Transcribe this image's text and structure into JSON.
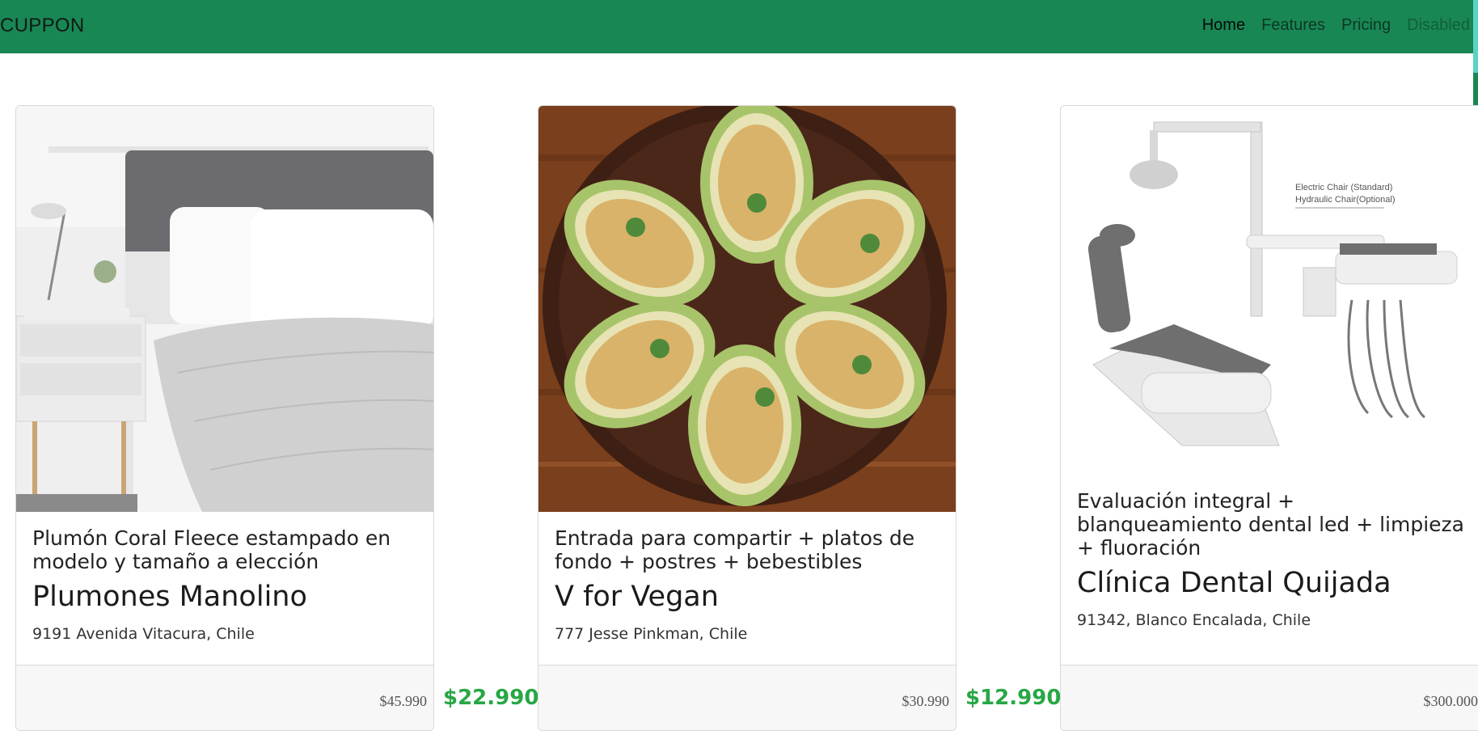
{
  "navbar": {
    "brand": "CUPPON",
    "links": [
      {
        "label": "Home",
        "state": "active"
      },
      {
        "label": "Features",
        "state": "normal"
      },
      {
        "label": "Pricing",
        "state": "normal"
      },
      {
        "label": "Disabled",
        "state": "disabled"
      }
    ],
    "color": "#198754"
  },
  "cards": [
    {
      "subtitle": "Plumón Coral Fleece estampado en modelo y tamaño a elección",
      "title": "Plumones Manolino",
      "address": "9191 Avenida Vitacura, Chile",
      "old_price": "$45.990",
      "new_price": "$22.990",
      "image": "bedroom-bedding-photo"
    },
    {
      "subtitle": "Entrada para compartir + platos de fondo + postres + bebestibles",
      "title": "V for Vegan",
      "address": "777 Jesse Pinkman, Chile",
      "old_price": "$30.990",
      "new_price": "$12.990",
      "image": "stuffed-avocados-photo"
    },
    {
      "subtitle": "Evaluación integral + blanqueamiento dental led + limpieza + fluoración",
      "title": "Clínica Dental Quijada",
      "address": "91342, Blanco Encalada, Chile",
      "old_price": "$300.000",
      "image": "dental-chair-photo",
      "image_caption": [
        "Electric Chair (Standard)",
        "Hydraulic Chair(Optional)"
      ]
    }
  ],
  "colors": {
    "price_green": "#28a745"
  }
}
